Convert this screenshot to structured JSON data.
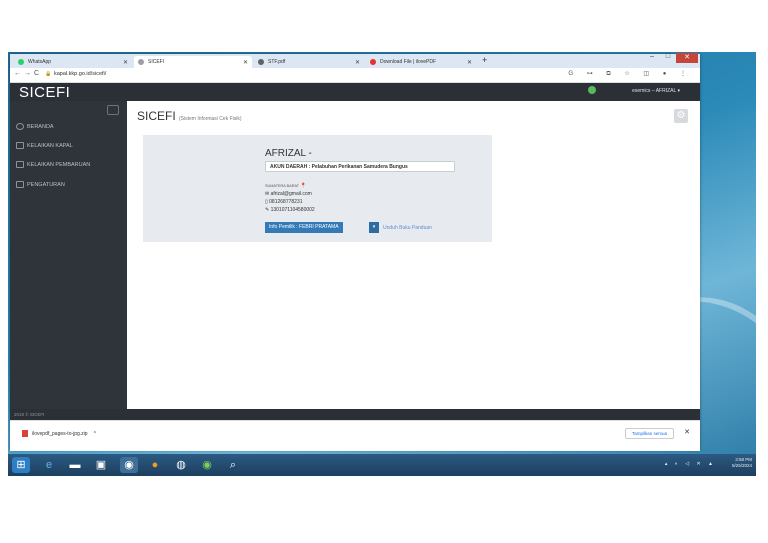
{
  "browser": {
    "tabs": [
      {
        "label": "WhatsApp",
        "color": "#25d366"
      },
      {
        "label": "SICEFI",
        "color": "#9aa0a6"
      },
      {
        "label": "STF.pdf",
        "color": "#5f6368"
      },
      {
        "label": "Download File | ilovePDF",
        "color": "#e5322d"
      }
    ],
    "new_tab": "+",
    "url": "kapal.kkp.go.id/sicefi/",
    "window_buttons": [
      "–",
      "□",
      "✕"
    ],
    "toolbar_icons": "G ⊶ ⧉ ☆ ◫ ●  ⋮"
  },
  "app": {
    "brand": "SICEFI",
    "user_menu": "esemics – AFRIZAL ▾",
    "sidebar": [
      {
        "label": "BERANDA",
        "icon": "circle-icon"
      },
      {
        "label": "KELAIKAN KAPAL",
        "icon": "square-icon"
      },
      {
        "label": "KELAIKAN PEMBARUAN",
        "icon": "square-icon"
      },
      {
        "label": "PENGATURAN",
        "icon": "square-icon"
      }
    ],
    "footer": "2019 © SICEFI"
  },
  "content": {
    "title": "SICEFI",
    "subtitle": "(Sistem Informasi Cek Fisik)",
    "profile": {
      "name": "AFRIZAL -",
      "akun": "AKUN DAERAH : Pelabuhan Perikanan Samudera Bungus",
      "region": "SUMATERA BARAT",
      "email": "afrizal@gmail.com",
      "phone": "081268778231",
      "id_number": "1301071104580002",
      "info_button": "Info Pemilik : FEBRI PRATAMA",
      "download_link": "Unduh Buku Panduan"
    }
  },
  "download_bar": {
    "file": "ilovepdf_pages-to-jpg.zip",
    "show_all": "Tampilkan semua",
    "close": "✕"
  },
  "taskbar": {
    "clock_time": "3:58 PM",
    "clock_date": "5/25/2024"
  }
}
